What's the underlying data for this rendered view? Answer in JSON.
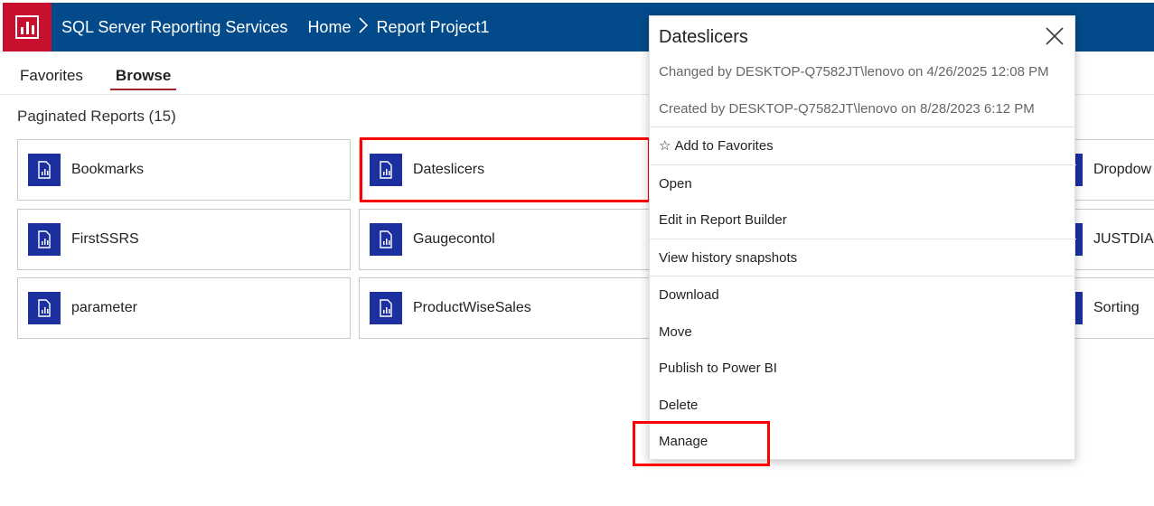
{
  "header": {
    "app_title": "SQL Server Reporting Services",
    "breadcrumb": {
      "home": "Home",
      "separator": ">",
      "current": "Report Project1"
    }
  },
  "nav": {
    "tabs": [
      "Favorites",
      "Browse"
    ],
    "active": "Browse"
  },
  "section": {
    "title": "Paginated Reports (15)"
  },
  "tiles": {
    "col1": [
      "Bookmarks",
      "FirstSSRS",
      "parameter"
    ],
    "col2": [
      "Dateslicers",
      "Gaugecontol",
      "ProductWiseSales"
    ],
    "col4": [
      "Dropdow",
      "JUSTDIAL",
      "Sorting"
    ]
  },
  "panel": {
    "title": "Dateslicers",
    "changed": "Changed by DESKTOP-Q7582JT\\lenovo on 4/26/2025 12:08 PM",
    "created": "Created by DESKTOP-Q7582JT\\lenovo on 8/28/2023 6:12 PM",
    "favorite": {
      "star": "☆",
      "label": "Add to Favorites"
    },
    "items": {
      "open": "Open",
      "edit": "Edit in Report Builder",
      "history": "View history snapshots",
      "download": "Download",
      "move": "Move",
      "publish": "Publish to Power BI",
      "delete": "Delete",
      "manage": "Manage"
    }
  },
  "colors": {
    "header_bg": "#034a8a",
    "logo_bg": "#c8102e",
    "tile_icon": "#1c2f9e",
    "highlight": "#ff0000",
    "active_tab_underline": "#a4262c"
  }
}
